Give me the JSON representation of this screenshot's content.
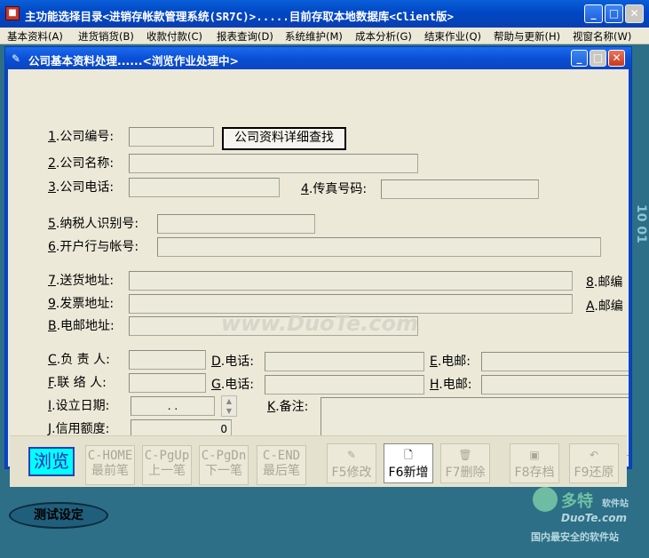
{
  "main_window": {
    "title": "主功能选择目录<进销存帐款管理系统(SR7C)>.....目前存取本地数据库<Client版>",
    "menu": [
      "基本资料(A)",
      "进货销货(B)",
      "收款付款(C)",
      "报表查询(D)",
      "系统维护(M)",
      "成本分析(G)",
      "结束作业(Q)",
      "帮助与更新(H)",
      "视窗名称(W)"
    ]
  },
  "child_window": {
    "title": "公司基本资料处理......<浏览作业处理中>"
  },
  "form": {
    "company_no": {
      "prefix": "1",
      "label": ".公司编号:",
      "value": ""
    },
    "lookup_button": "公司资料详细查找",
    "company_name": {
      "prefix": "2",
      "label": ".公司名称:",
      "value": ""
    },
    "company_phone": {
      "prefix": "3",
      "label": ".公司电话:",
      "value": ""
    },
    "fax": {
      "prefix": "4",
      "label": ".传真号码:",
      "value": ""
    },
    "tax_id": {
      "prefix": "5",
      "label": ".纳税人识别号:",
      "value": ""
    },
    "bank_account": {
      "prefix": "6",
      "label": ".开户行与帐号:",
      "value": ""
    },
    "delivery_address": {
      "prefix": "7",
      "label": ".送货地址:",
      "value": ""
    },
    "delivery_zip": {
      "prefix": "8",
      "label": ".邮编"
    },
    "invoice_address": {
      "prefix": "9",
      "label": ".发票地址:",
      "value": ""
    },
    "invoice_zip": {
      "prefix": "A",
      "label": ".邮编"
    },
    "email_address": {
      "prefix": "B",
      "label": ".电邮地址:",
      "value": ""
    },
    "person_in_charge": {
      "prefix": "C",
      "label": ".负 责 人:",
      "value": ""
    },
    "phone_d": {
      "prefix": "D",
      "label": ".电话:",
      "value": ""
    },
    "email_e": {
      "prefix": "E",
      "label": ".电邮:",
      "value": ""
    },
    "contact": {
      "prefix": "F",
      "label": ".联 络 人:",
      "value": ""
    },
    "phone_g": {
      "prefix": "G",
      "label": ".电话:",
      "value": ""
    },
    "email_h": {
      "prefix": "H",
      "label": ".电邮:",
      "value": ""
    },
    "setup_date": {
      "prefix": "I",
      "label": ".设立日期:",
      "value": ". ."
    },
    "remarks": {
      "prefix": "K",
      "label": ".备注:",
      "value": ""
    },
    "credit_limit": {
      "prefix": "J",
      "label": ".信用额度:",
      "value": "0"
    }
  },
  "toolbar": {
    "mode": "浏览",
    "nav": [
      {
        "key": "C-HOME",
        "label": "最前笔"
      },
      {
        "key": "C-PgUp",
        "label": "上一笔"
      },
      {
        "key": "C-PgDn",
        "label": "下一笔"
      },
      {
        "key": "C-END",
        "label": "最后笔"
      }
    ],
    "actions": [
      {
        "label": "F5修改",
        "icon": "edit-icon",
        "enabled": false
      },
      {
        "label": "F6新增",
        "icon": "new-doc-icon",
        "enabled": true
      },
      {
        "label": "F7删除",
        "icon": "delete-icon",
        "enabled": false
      },
      {
        "label": "F8存档",
        "icon": "save-icon",
        "enabled": false
      },
      {
        "label": "F9还原",
        "icon": "undo-icon",
        "enabled": false
      }
    ]
  },
  "bottom": {
    "test_button": "测试设定"
  },
  "watermarks": {
    "center": "www.DuoTe.com",
    "logo_cn": "多特",
    "logo_sub": "软件站",
    "logo_url": "DuoTe.com",
    "logo_slogan": "国内最安全的软件站",
    "edge": "10 01"
  },
  "colors": {
    "titlebar": "#0a4fd6",
    "desktop": "#2c6f86",
    "mode_box": "#00ffff",
    "form_bg": "#ece9d8"
  }
}
